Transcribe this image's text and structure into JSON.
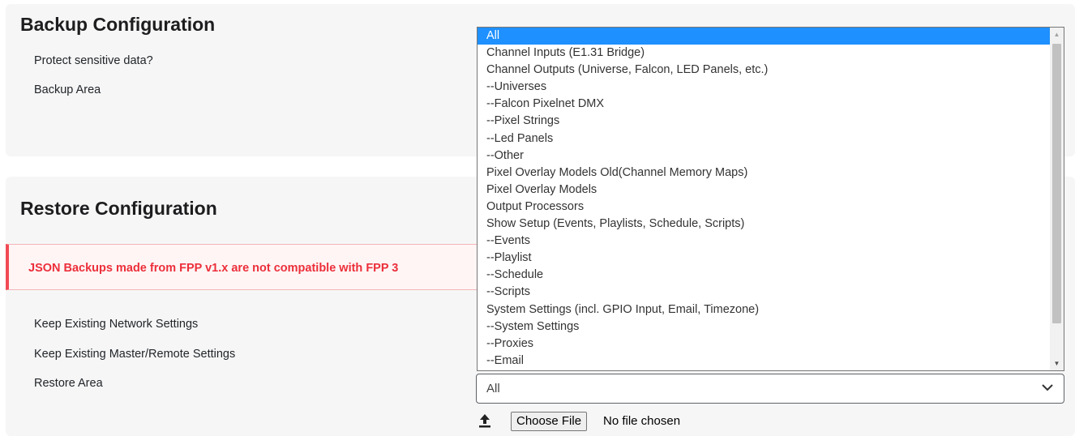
{
  "backup": {
    "title": "Backup Configuration",
    "protect_label": "Protect sensitive data?",
    "area_label": "Backup Area"
  },
  "restore": {
    "title": "Restore Configuration",
    "alert": "JSON Backups made from FPP v1.x are not compatible with FPP 3",
    "keep_network_label": "Keep Existing Network Settings",
    "keep_master_label": "Keep Existing Master/Remote Settings",
    "area_label": "Restore Area",
    "area_selected": "All",
    "choose_file_label": "Choose File",
    "no_file_label": "No file chosen"
  },
  "dropdown": {
    "options": [
      "All",
      "Channel Inputs (E1.31 Bridge)",
      "Channel Outputs (Universe, Falcon, LED Panels, etc.)",
      "--Universes",
      "--Falcon Pixelnet DMX",
      "--Pixel Strings",
      "--Led Panels",
      "--Other",
      "Pixel Overlay Models Old(Channel Memory Maps)",
      "Pixel Overlay Models",
      "Output Processors",
      "Show Setup (Events, Playlists, Schedule, Scripts)",
      "--Events",
      "--Playlist",
      "--Schedule",
      "--Scripts",
      "System Settings (incl. GPIO Input, Email, Timezone)",
      "--System Settings",
      "--Proxies",
      "--Email"
    ],
    "selected_index": 0
  },
  "colors": {
    "highlight": "#1e90ff",
    "alert_text": "#ec2f3a",
    "alert_border": "#f14a54"
  },
  "icons": {
    "upload": "upload-icon",
    "chevron": "chevron-down-icon"
  }
}
